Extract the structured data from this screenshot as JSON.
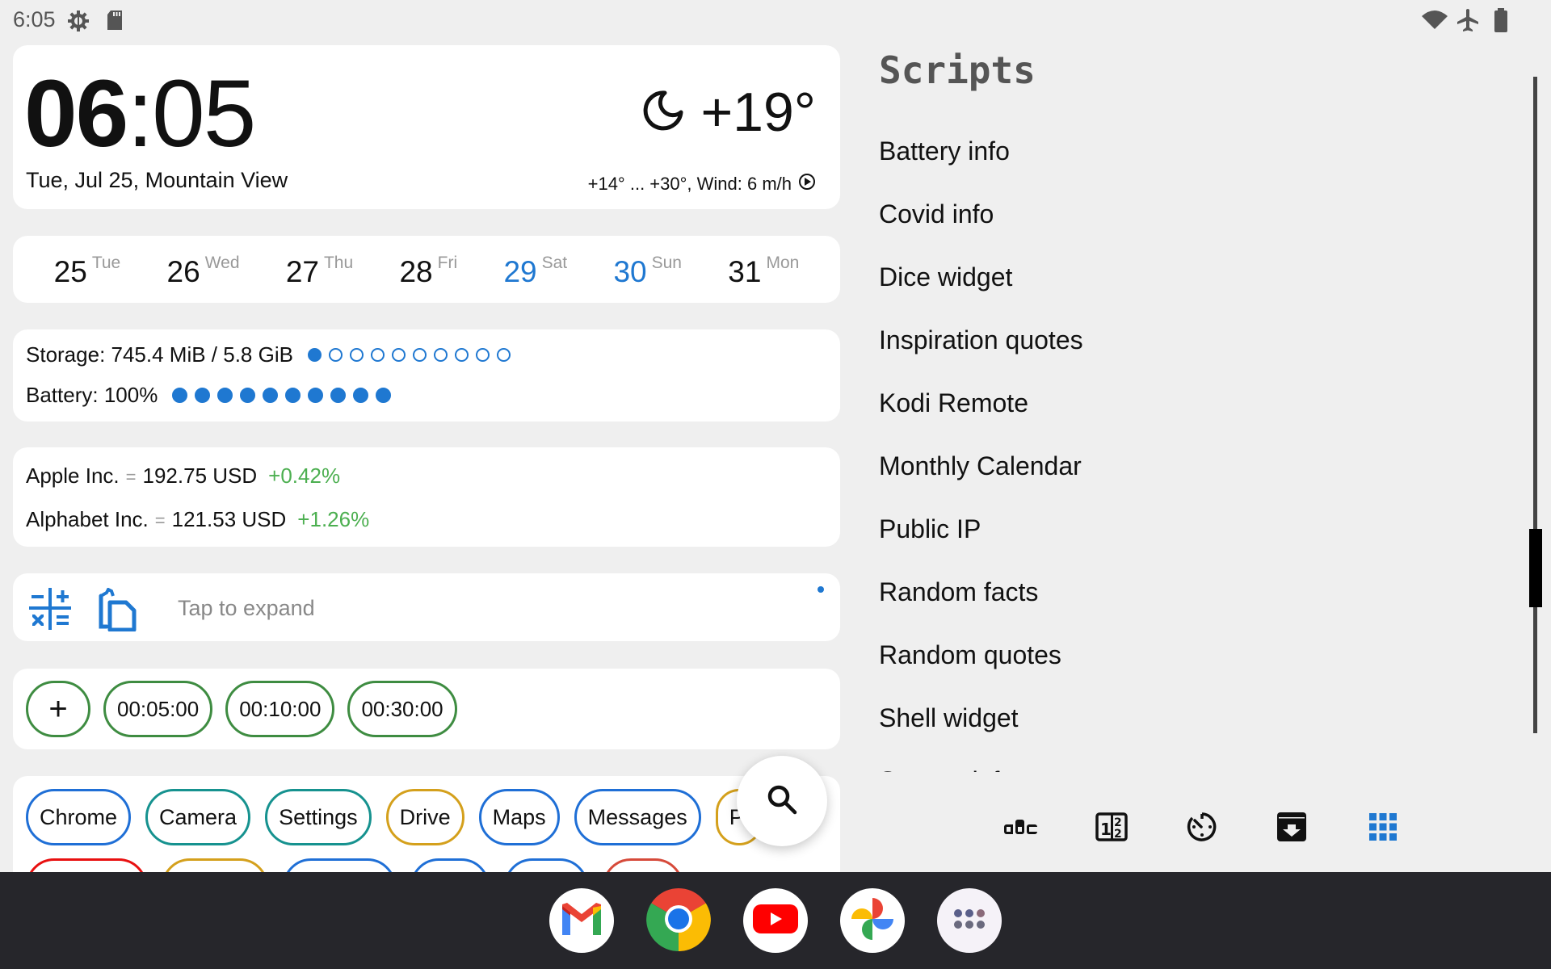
{
  "status_bar": {
    "time": "6:05",
    "left_icons": [
      "settings-gear-icon",
      "sd-card-icon"
    ],
    "right_icons": [
      "wifi-icon",
      "airplane-mode-icon",
      "battery-icon"
    ]
  },
  "clock_widget": {
    "hours": "06",
    "colon": ":",
    "minutes": "05",
    "date_location": "Tue, Jul 25, Mountain View",
    "weather_icon": "moon-icon",
    "temperature": "+19°",
    "forecast": "+14° ... +30°, Wind: 6 m/h",
    "wind_direction_icon": "wind-direction-icon"
  },
  "calendar_strip": [
    {
      "day": "25",
      "dow": "Tue",
      "weekend": false
    },
    {
      "day": "26",
      "dow": "Wed",
      "weekend": false
    },
    {
      "day": "27",
      "dow": "Thu",
      "weekend": false
    },
    {
      "day": "28",
      "dow": "Fri",
      "weekend": false
    },
    {
      "day": "29",
      "dow": "Sat",
      "weekend": true
    },
    {
      "day": "30",
      "dow": "Sun",
      "weekend": true
    },
    {
      "day": "31",
      "dow": "Mon",
      "weekend": false
    }
  ],
  "monitor": {
    "storage_label": "Storage: 745.4 MiB / 5.8 GiB",
    "storage_filled_dots": 1,
    "storage_total_dots": 10,
    "battery_label": "Battery: 100%",
    "battery_filled_dots": 10,
    "battery_total_dots": 10
  },
  "stocks": [
    {
      "name": "Apple Inc.",
      "eq": "=",
      "price": "192.75 USD",
      "change": "+0.42%"
    },
    {
      "name": "Alphabet Inc.",
      "eq": "=",
      "price": "121.53 USD",
      "change": "+1.26%"
    }
  ],
  "tools": {
    "calculator_icon": "calculator-icon",
    "clipboard_icon": "clipboard-icon",
    "tap_text": "Tap to expand"
  },
  "timers": {
    "add_label": "+",
    "presets": [
      "00:05:00",
      "00:10:00",
      "00:30:00"
    ]
  },
  "apps": {
    "row1": [
      {
        "label": "Chrome",
        "color": "#1f6fd6"
      },
      {
        "label": "Camera",
        "color": "#16928f"
      },
      {
        "label": "Settings",
        "color": "#16928f"
      },
      {
        "label": "Drive",
        "color": "#d4a01c"
      },
      {
        "label": "Maps",
        "color": "#1f6fd6"
      },
      {
        "label": "Messages",
        "color": "#1f6fd6"
      },
      {
        "label": "Pl",
        "color": "#d4a01c"
      }
    ],
    "row2_colors": [
      "#e81010",
      "#d4a01c",
      "#1f6fd6",
      "#1f6fd6",
      "#1f6fd6",
      "#d64a3a"
    ],
    "search_icon": "search-icon"
  },
  "scripts_panel": {
    "title": "Scripts",
    "items": [
      "Battery info",
      "Covid info",
      "Dice widget",
      "Inspiration quotes",
      "Kodi Remote",
      "Monthly Calendar",
      "Public IP",
      "Random facts",
      "Random quotes",
      "Shell widget",
      "System info"
    ],
    "bottom_tabs": [
      "abc-icon",
      "numbers-icon",
      "timer-icon",
      "archive-icon",
      "apps-grid-icon"
    ],
    "active_tab": "apps-grid-icon",
    "accent": "#1f78d1"
  },
  "dock": [
    "Gmail",
    "Chrome",
    "YouTube",
    "Photos",
    "App drawer"
  ]
}
